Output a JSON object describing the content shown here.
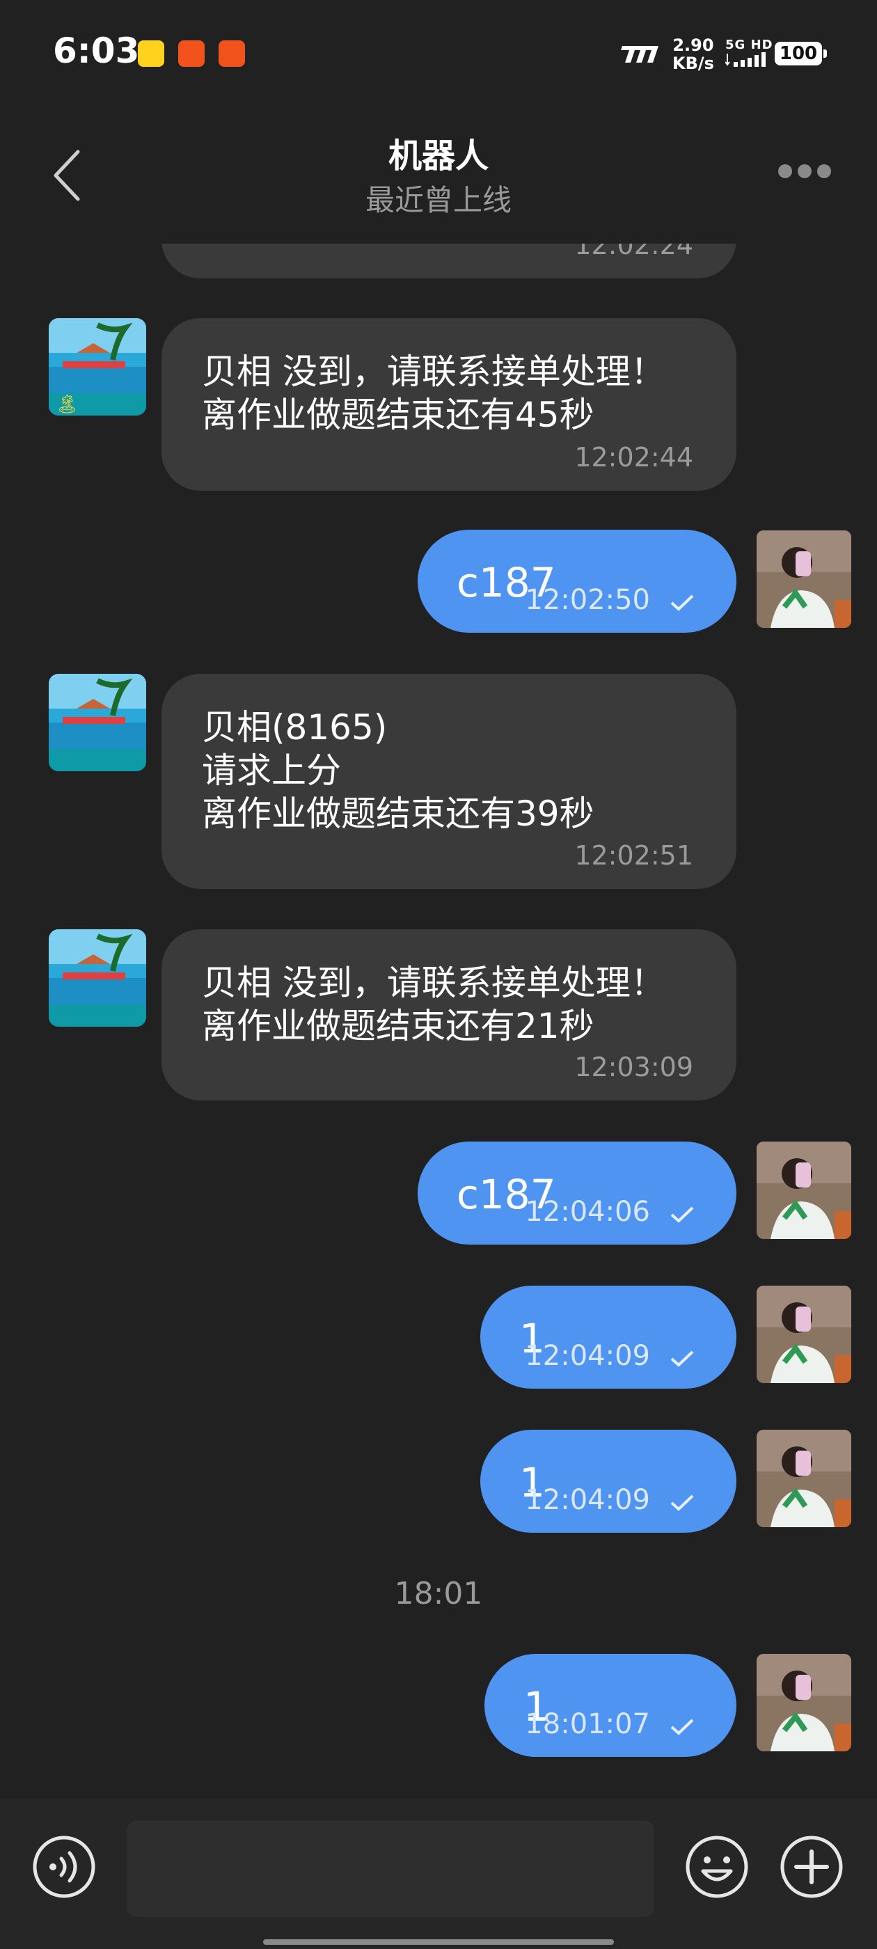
{
  "status_bar": {
    "time": "6:03",
    "net_speed_value": "2.90",
    "net_speed_unit": "KB/s",
    "signal_label": "5G HD",
    "battery": "100"
  },
  "header": {
    "title": "机器人",
    "subtitle": "最近曾上线"
  },
  "messages": [
    {
      "side": "in",
      "text": "",
      "time": "12:02:24"
    },
    {
      "side": "in",
      "text": "贝相 没到，请联系接单处理！\n离作业做题结束还有45秒",
      "time": "12:02:44"
    },
    {
      "side": "out",
      "text": "c187",
      "time": "12:02:50"
    },
    {
      "side": "in",
      "text": "贝相(8165)\n请求上分\n离作业做题结束还有39秒",
      "time": "12:02:51"
    },
    {
      "side": "in",
      "text": "贝相 没到，请联系接单处理！\n离作业做题结束还有21秒",
      "time": "12:03:09"
    },
    {
      "side": "out",
      "text": "c187",
      "time": "12:04:06"
    },
    {
      "side": "out",
      "text": "1",
      "time": "12:04:09"
    },
    {
      "side": "out",
      "text": "1",
      "time": "12:04:09"
    },
    {
      "side": "divider",
      "text": "18:01"
    },
    {
      "side": "out",
      "text": "1",
      "time": "18:01:07"
    }
  ],
  "colors": {
    "background": "#212121",
    "incoming_bubble": "#3a3a3a",
    "outgoing_bubble": "#5094f2"
  }
}
